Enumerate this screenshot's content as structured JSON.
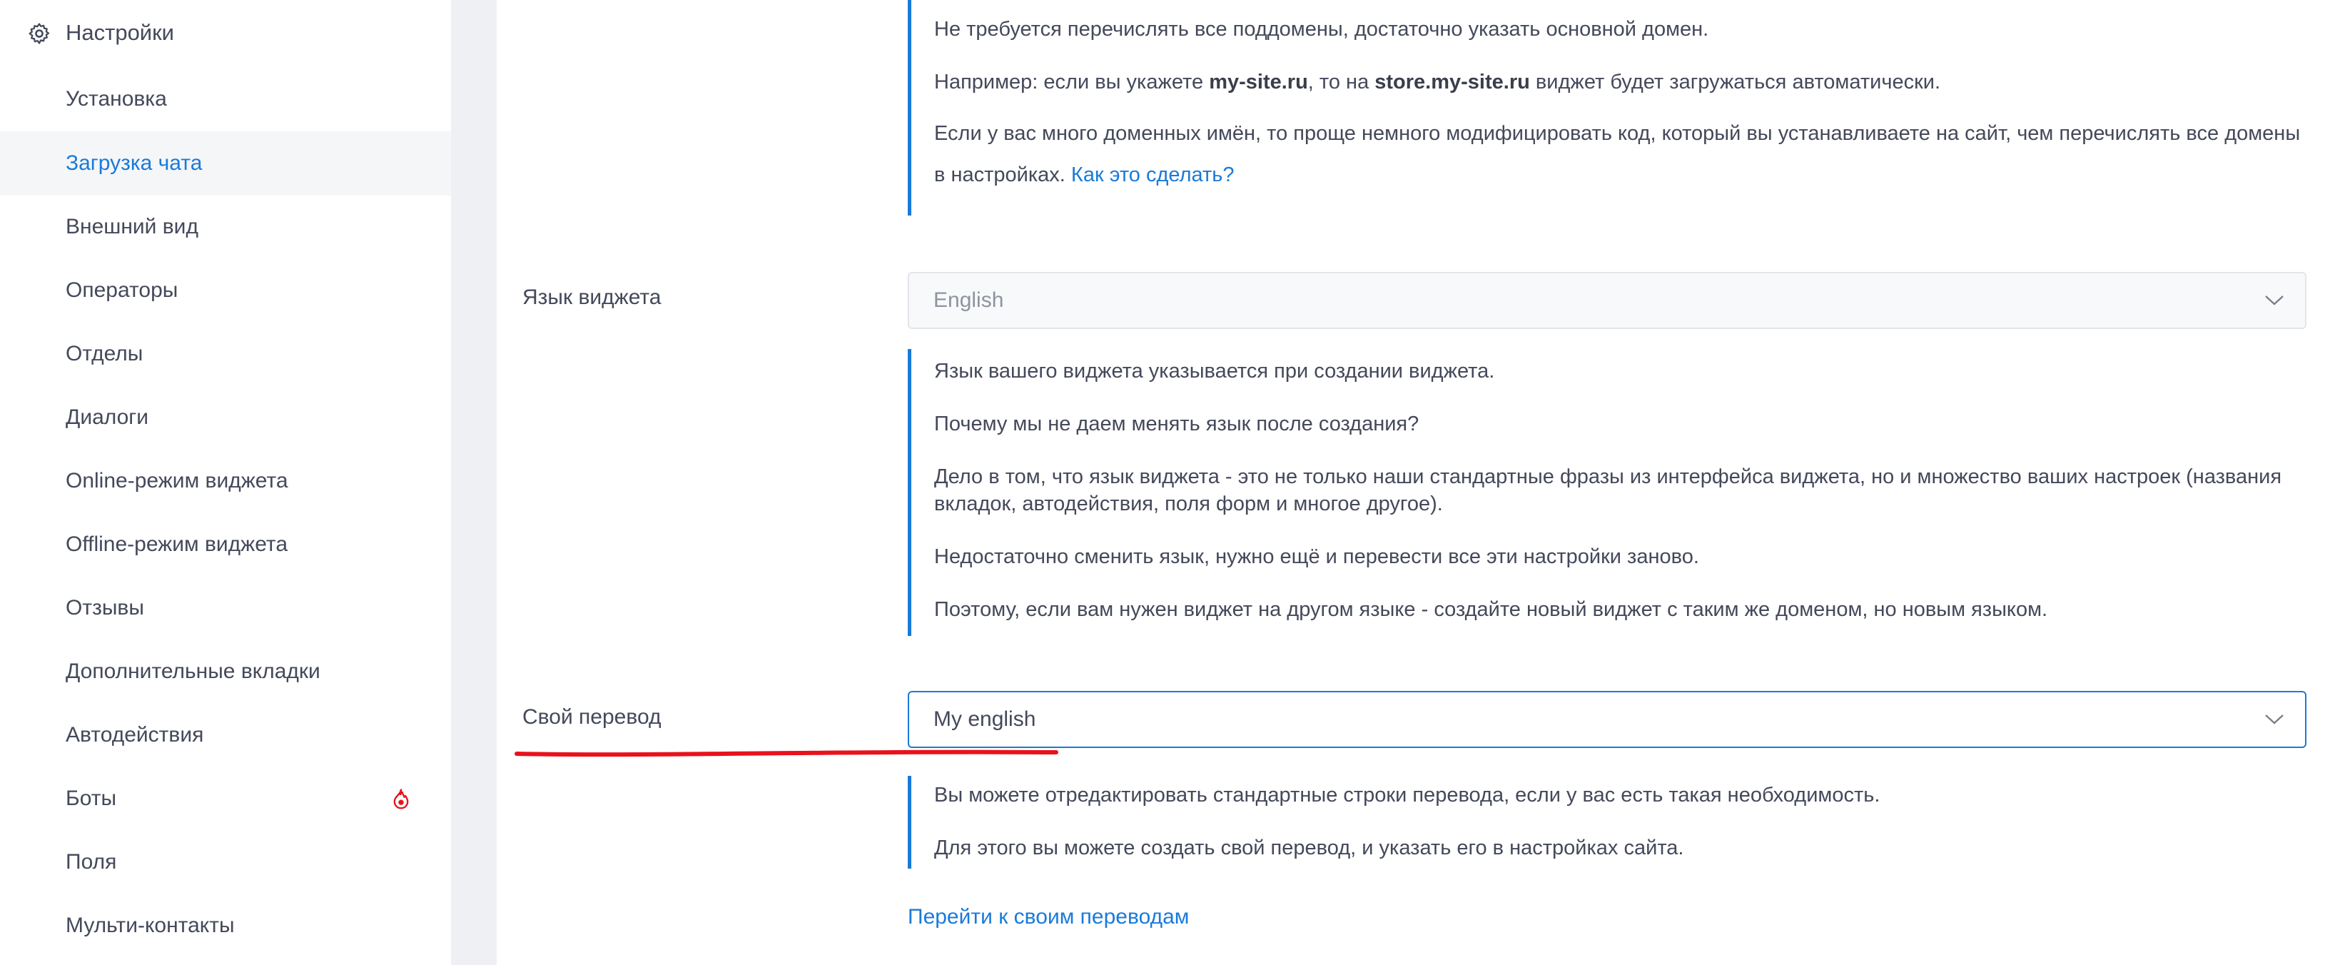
{
  "sidebar": {
    "header": {
      "label": "Настройки",
      "icon": "gear-icon"
    },
    "items": [
      {
        "label": "Установка",
        "active": false
      },
      {
        "label": "Загрузка чата",
        "active": true
      },
      {
        "label": "Внешний вид",
        "active": false
      },
      {
        "label": "Операторы",
        "active": false
      },
      {
        "label": "Отделы",
        "active": false
      },
      {
        "label": "Диалоги",
        "active": false
      },
      {
        "label": "Online-режим виджета",
        "active": false
      },
      {
        "label": "Offline-режим виджета",
        "active": false
      },
      {
        "label": "Отзывы",
        "active": false
      },
      {
        "label": "Дополнительные вкладки",
        "active": false
      },
      {
        "label": "Автодействия",
        "active": false
      },
      {
        "label": "Боты",
        "active": false,
        "badge_icon": "flame-icon"
      },
      {
        "label": "Поля",
        "active": false
      },
      {
        "label": "Мульти-контакты",
        "active": false
      }
    ]
  },
  "domain_note": {
    "line1": "Не требуется перечислять все поддомены, достаточно указать основной домен.",
    "line2_pre": "Например: если вы укажете ",
    "line2_bold1": "my-site.ru",
    "line2_mid": ", то на ",
    "line2_bold2": "store.my-site.ru",
    "line2_post": " виджет будет загружаться автоматически.",
    "line3": "Если у вас много доменных имён, то проще немного модифицировать код, который вы устанавливаете на сайт, чем перечислять все домены в настройках.",
    "line3_link": "Как это сделать?"
  },
  "widget_language": {
    "label": "Язык виджета",
    "value": "English",
    "notes": [
      "Язык вашего виджета указывается при создании виджета.",
      "Почему мы не даем менять язык после создания?",
      "Дело в том, что язык виджета - это не только наши стандартные фразы из интерфейса виджета, но и множество ваших настроек (названия вкладок, автодействия, поля форм и многое другое).",
      "Недостаточно сменить язык, нужно ещё и перевести все эти настройки заново.",
      "Поэтому, если вам нужен виджет на другом языке - создайте новый виджет с таким же доменом, но новым языком."
    ]
  },
  "custom_translation": {
    "label": "Свой перевод",
    "value": "My english",
    "notes": [
      "Вы можете отредактировать стандартные строки перевода, если у вас есть такая необходимость.",
      "Для этого вы можете создать свой перевод, и указать его в настройках сайта."
    ],
    "link": "Перейти к своим переводам"
  },
  "colors": {
    "accent": "#1a7ad9",
    "text": "#44495a",
    "annotation": "#e8121b"
  }
}
